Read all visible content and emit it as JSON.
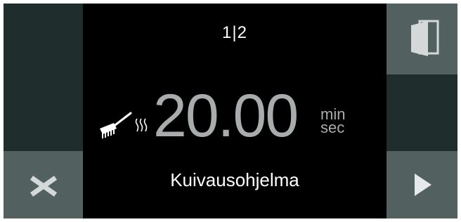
{
  "header": {
    "page_indicator": "1|2"
  },
  "timer": {
    "value": "20.00",
    "unit_top": "min",
    "unit_bottom": "sec"
  },
  "program": {
    "name": "Kuivausohjelma"
  },
  "icons": {
    "left_bottom": "close-x-icon",
    "right_top": "door-open-icon",
    "right_bottom": "play-next-icon",
    "timer_left": "brush-icon",
    "timer_steam": "steam-icon"
  },
  "colors": {
    "background": "#000000",
    "panel_dark": "#1f2d2d",
    "panel_light": "#536060",
    "text_primary": "#ffffff",
    "text_secondary": "#a9acac"
  }
}
